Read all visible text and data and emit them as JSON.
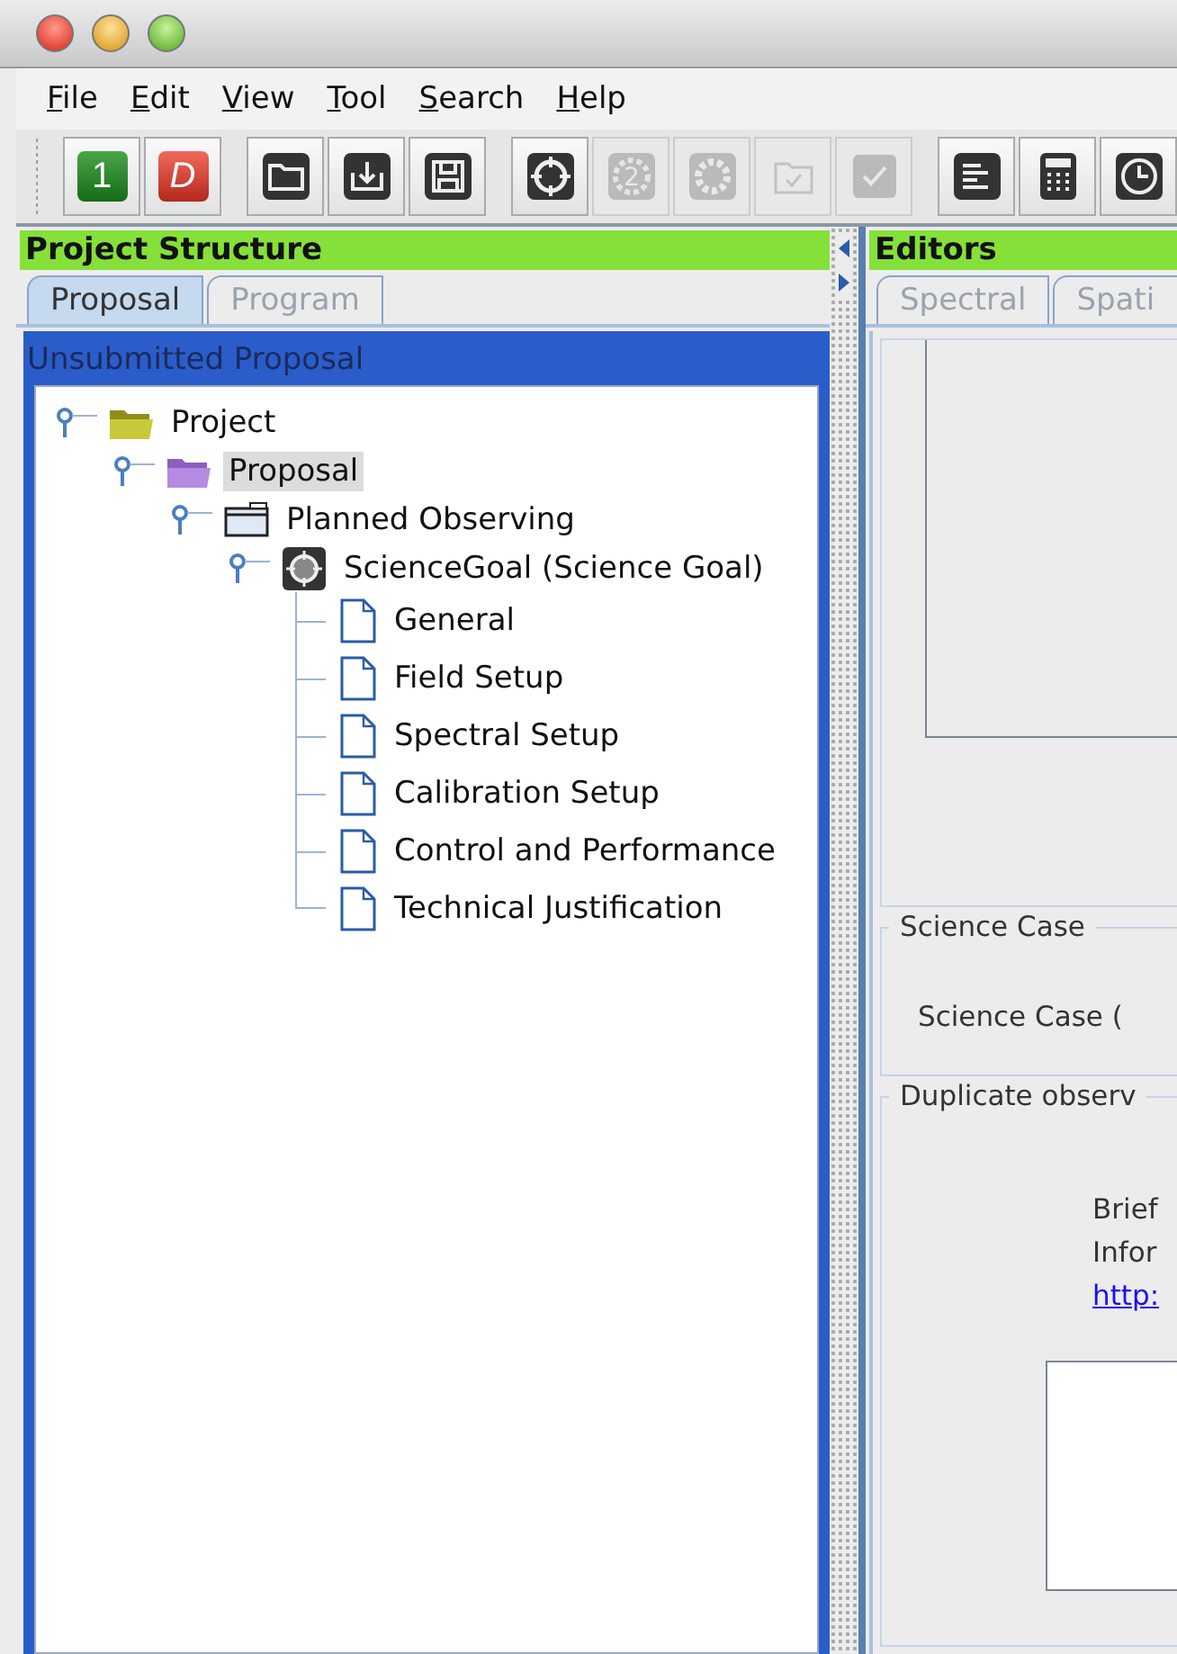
{
  "menu": [
    "File",
    "Edit",
    "View",
    "Tool",
    "Search",
    "Help"
  ],
  "toolbar": [
    {
      "buttons": [
        {
          "kind": "green",
          "glyph": "1",
          "disabled": false
        },
        {
          "kind": "red",
          "glyph": "D",
          "disabled": false
        }
      ]
    },
    {
      "buttons": [
        {
          "kind": "folder",
          "disabled": false
        },
        {
          "kind": "import",
          "disabled": false
        },
        {
          "kind": "save",
          "disabled": false
        }
      ]
    },
    {
      "buttons": [
        {
          "kind": "target",
          "disabled": false
        },
        {
          "kind": "numbered",
          "glyph": "2",
          "disabled": true
        },
        {
          "kind": "gear",
          "disabled": true
        },
        {
          "kind": "stack",
          "disabled": true
        },
        {
          "kind": "check",
          "disabled": true
        }
      ]
    },
    {
      "buttons": [
        {
          "kind": "bars",
          "disabled": false
        },
        {
          "kind": "calculator",
          "disabled": false
        },
        {
          "kind": "clock",
          "disabled": false
        }
      ]
    }
  ],
  "project_structure": {
    "title": "Project Structure",
    "tabs": [
      {
        "label": "Proposal",
        "selected": true
      },
      {
        "label": "Program",
        "selected": false
      }
    ],
    "status": "Unsubmitted Proposal",
    "tree": [
      {
        "label": "Project",
        "kind": "project",
        "expanded": true,
        "selected": false,
        "children": [
          {
            "label": "Proposal",
            "kind": "proposal",
            "expanded": true,
            "selected": true,
            "children": [
              {
                "label": "Planned Observing",
                "kind": "observing",
                "expanded": true,
                "selected": false,
                "children": [
                  {
                    "label": "ScienceGoal (Science Goal)",
                    "kind": "goal",
                    "expanded": true,
                    "selected": false,
                    "children": [
                      {
                        "label": "General",
                        "kind": "page",
                        "selected": false
                      },
                      {
                        "label": "Field Setup",
                        "kind": "page",
                        "selected": false
                      },
                      {
                        "label": "Spectral Setup",
                        "kind": "page",
                        "selected": false
                      },
                      {
                        "label": "Calibration Setup",
                        "kind": "page",
                        "selected": false
                      },
                      {
                        "label": "Control and Performance",
                        "kind": "page",
                        "selected": false
                      },
                      {
                        "label": "Technical Justification",
                        "kind": "page",
                        "selected": false
                      }
                    ]
                  }
                ]
              }
            ]
          }
        ]
      }
    ]
  },
  "editors": {
    "title": "Editors",
    "tabs": [
      {
        "label": "Spectral",
        "selected": false
      },
      {
        "label": "Spati",
        "selected": false
      }
    ],
    "science_case": {
      "title": "Science Case",
      "label": "Science Case ("
    },
    "duplicate": {
      "title": "Duplicate observ",
      "lines": [
        "Brief",
        "Infor"
      ],
      "link": "http:"
    }
  }
}
